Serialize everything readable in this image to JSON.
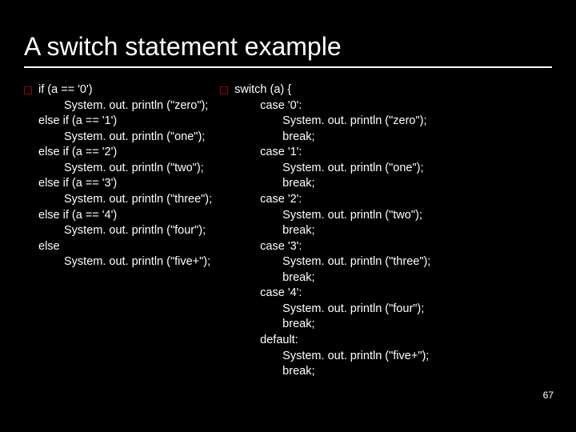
{
  "title": "A switch statement example",
  "page_number": "67",
  "left": {
    "l1": "if (a == '0')",
    "l2": "System. out. println (\"zero\");",
    "l3": "else if (a == '1')",
    "l4": "System. out. println (\"one\");",
    "l5": "else if (a == '2')",
    "l6": "System. out. println (\"two\");",
    "l7": "else if (a == '3')",
    "l8": "System. out. println (\"three\");",
    "l9": "else if (a == '4')",
    "l10": "System. out. println (\"four\");",
    "l11": "else",
    "l12": "System. out. println (\"five+\");"
  },
  "right": {
    "r1": "switch (a) {",
    "r2": "case '0':",
    "r3": "System. out. println (\"zero\");",
    "r4": "break;",
    "r5": "case '1':",
    "r6": "System. out. println (\"one\");",
    "r7": "break;",
    "r8": "case '2':",
    "r9": "System. out. println (\"two\");",
    "r10": "break;",
    "r11": "case '3':",
    "r12": "System. out. println (\"three\");",
    "r13": "break;",
    "r14": "case '4':",
    "r15": "System. out. println (\"four\");",
    "r16": "break;",
    "r17": "default:",
    "r18": "System. out. println (\"five+\");",
    "r19": "break;"
  }
}
